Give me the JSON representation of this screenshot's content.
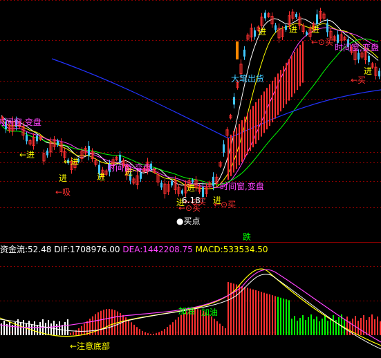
{
  "colors": {
    "background": "#000000",
    "up_candle": "#ff3030",
    "down_candle": "#40c8ff",
    "grid": "#8b0000",
    "long_ma": "#2233ff",
    "dif_line": "#ffffff",
    "dea_line": "#ffff00",
    "money_flow_line": "#ff44ff",
    "macd_up": "#ff3030",
    "macd_down": "#00ff00"
  },
  "annotations": {
    "jin_1": "进",
    "jin_2": "进",
    "jin_3": "进",
    "jin_4": "进",
    "jin_5": "进",
    "jin_6": "进",
    "jin_7": "进",
    "jin_8": "进",
    "jin_9": "进",
    "jin_10": "进",
    "arrow_jin_1": "←进",
    "arrow_jin_2": "←进",
    "xi": "←吸",
    "time_window_1": "时间窗,变盘",
    "time_window_2": "时间窗,变盘",
    "time_window_3": "时间窗,变盘",
    "time_window_4": "时间窗,变盘",
    "buy_1": "←⊙买",
    "buy_2": "←⊙买",
    "buy_3": "←⊙买",
    "buy_4": "←⊙买",
    "buy_5": "←买",
    "price_low": "6.18",
    "buy_point": "●买点",
    "big_sell": "大笔出货",
    "die": "跌",
    "jia_you_1": "加油",
    "jia_you_2": "加油",
    "bottom_note": "←注意底部"
  },
  "status_bar": {
    "money_flow_label": "资金流:",
    "money_flow_value": "52.48",
    "dif_label": "DIF:",
    "dif_value": "1708976.00",
    "dea_label": "DEA:",
    "dea_value": "1442208.75",
    "macd_label": "MACD:",
    "macd_value": "533534.50"
  }
}
